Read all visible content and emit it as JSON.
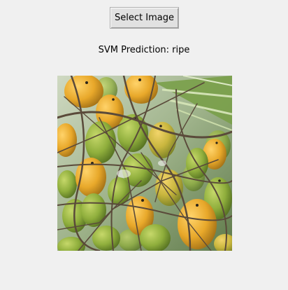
{
  "window": {
    "button_label": "Select Image",
    "prediction_text": "SVM Prediction: ripe"
  },
  "image": {
    "subject": "cluster of ripening areca (betel) nuts on palm",
    "colors": {
      "green_fruit": "#8fae3c",
      "ripe_fruit": "#e8a82a",
      "stem": "#5a4a3a",
      "leaf": "#6b8f3a",
      "background": "#b7c7a8"
    }
  }
}
